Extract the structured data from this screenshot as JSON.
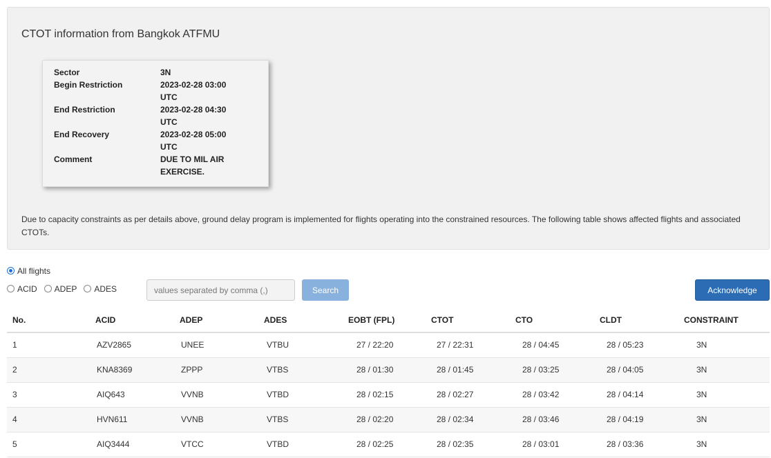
{
  "panel": {
    "title": "CTOT information from Bangkok ATFMU",
    "info": {
      "rows": [
        {
          "key": "Sector",
          "value_lines": [
            "3N"
          ]
        },
        {
          "key": "Begin Restriction",
          "value_lines": [
            "2023-02-28 03:00",
            "UTC"
          ]
        },
        {
          "key": "End Restriction",
          "value_lines": [
            "2023-02-28 04:30",
            "UTC"
          ]
        },
        {
          "key": "End Recovery",
          "value_lines": [
            "2023-02-28 05:00",
            "UTC"
          ]
        },
        {
          "key": "Comment",
          "value_lines": [
            "DUE TO MIL AIR",
            "EXERCISE."
          ]
        }
      ]
    },
    "description": "Due to capacity constraints as per details above, ground delay program is implemented for flights operating into the constrained resources. The following table shows affected flights and associated CTOTs."
  },
  "filters": {
    "all_flights_label": "All flights",
    "acid_label": "ACID",
    "adep_label": "ADEP",
    "ades_label": "ADES",
    "search_placeholder": "values separated by comma (,)",
    "search_label": "Search",
    "acknowledge_label": "Acknowledge",
    "selected": "All flights"
  },
  "table": {
    "headers": [
      "No.",
      "ACID",
      "ADEP",
      "ADES",
      "EOBT (FPL)",
      "CTOT",
      "CTO",
      "CLDT",
      "CONSTRAINT"
    ],
    "rows": [
      [
        "1",
        "AZV2865",
        "UNEE",
        "VTBU",
        "27 / 22:20",
        "27 / 22:31",
        "28 / 04:45",
        "28 / 05:23",
        "3N"
      ],
      [
        "2",
        "KNA8369",
        "ZPPP",
        "VTBS",
        "28 / 01:30",
        "28 / 01:45",
        "28 / 03:25",
        "28 / 04:05",
        "3N"
      ],
      [
        "3",
        "AIQ643",
        "VVNB",
        "VTBD",
        "28 / 02:15",
        "28 / 02:27",
        "28 / 03:42",
        "28 / 04:14",
        "3N"
      ],
      [
        "4",
        "HVN611",
        "VVNB",
        "VTBS",
        "28 / 02:20",
        "28 / 02:34",
        "28 / 03:46",
        "28 / 04:19",
        "3N"
      ],
      [
        "5",
        "AIQ3444",
        "VTCC",
        "VTBD",
        "28 / 02:25",
        "28 / 02:35",
        "28 / 03:01",
        "28 / 03:36",
        "3N"
      ]
    ]
  },
  "colors": {
    "primary": "#2b6cb5",
    "search_button": "#88b2dd",
    "panel_bg": "#f1f1f1"
  }
}
